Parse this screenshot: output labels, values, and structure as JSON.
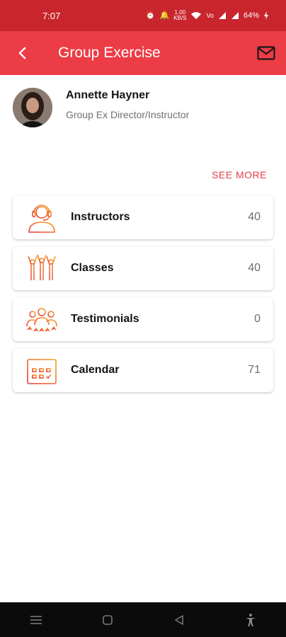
{
  "status": {
    "time": "7:07",
    "data_speed": "1.00\nKB/S",
    "battery": "64%"
  },
  "header": {
    "title": "Group Exercise",
    "back_icon": "chevron-left-icon",
    "mail_icon": "mail-icon"
  },
  "profile": {
    "name": "Annette Hayner",
    "role": "Group Ex Director/Instructor"
  },
  "see_more": "SEE MORE",
  "menu": {
    "items": [
      {
        "label": "Instructors",
        "count": "40",
        "icon": "instructor-headset-icon"
      },
      {
        "label": "Classes",
        "count": "40",
        "icon": "classes-group-icon"
      },
      {
        "label": "Testimonials",
        "count": "0",
        "icon": "testimonials-icon"
      },
      {
        "label": "Calendar",
        "count": "71",
        "icon": "calendar-icon"
      }
    ]
  },
  "colors": {
    "status_bar": "#c8252d",
    "app_bar": "#ec3c45",
    "accent": "#e0404a",
    "icon_gradient_start": "#e8343d",
    "icon_gradient_end": "#f5a623"
  }
}
